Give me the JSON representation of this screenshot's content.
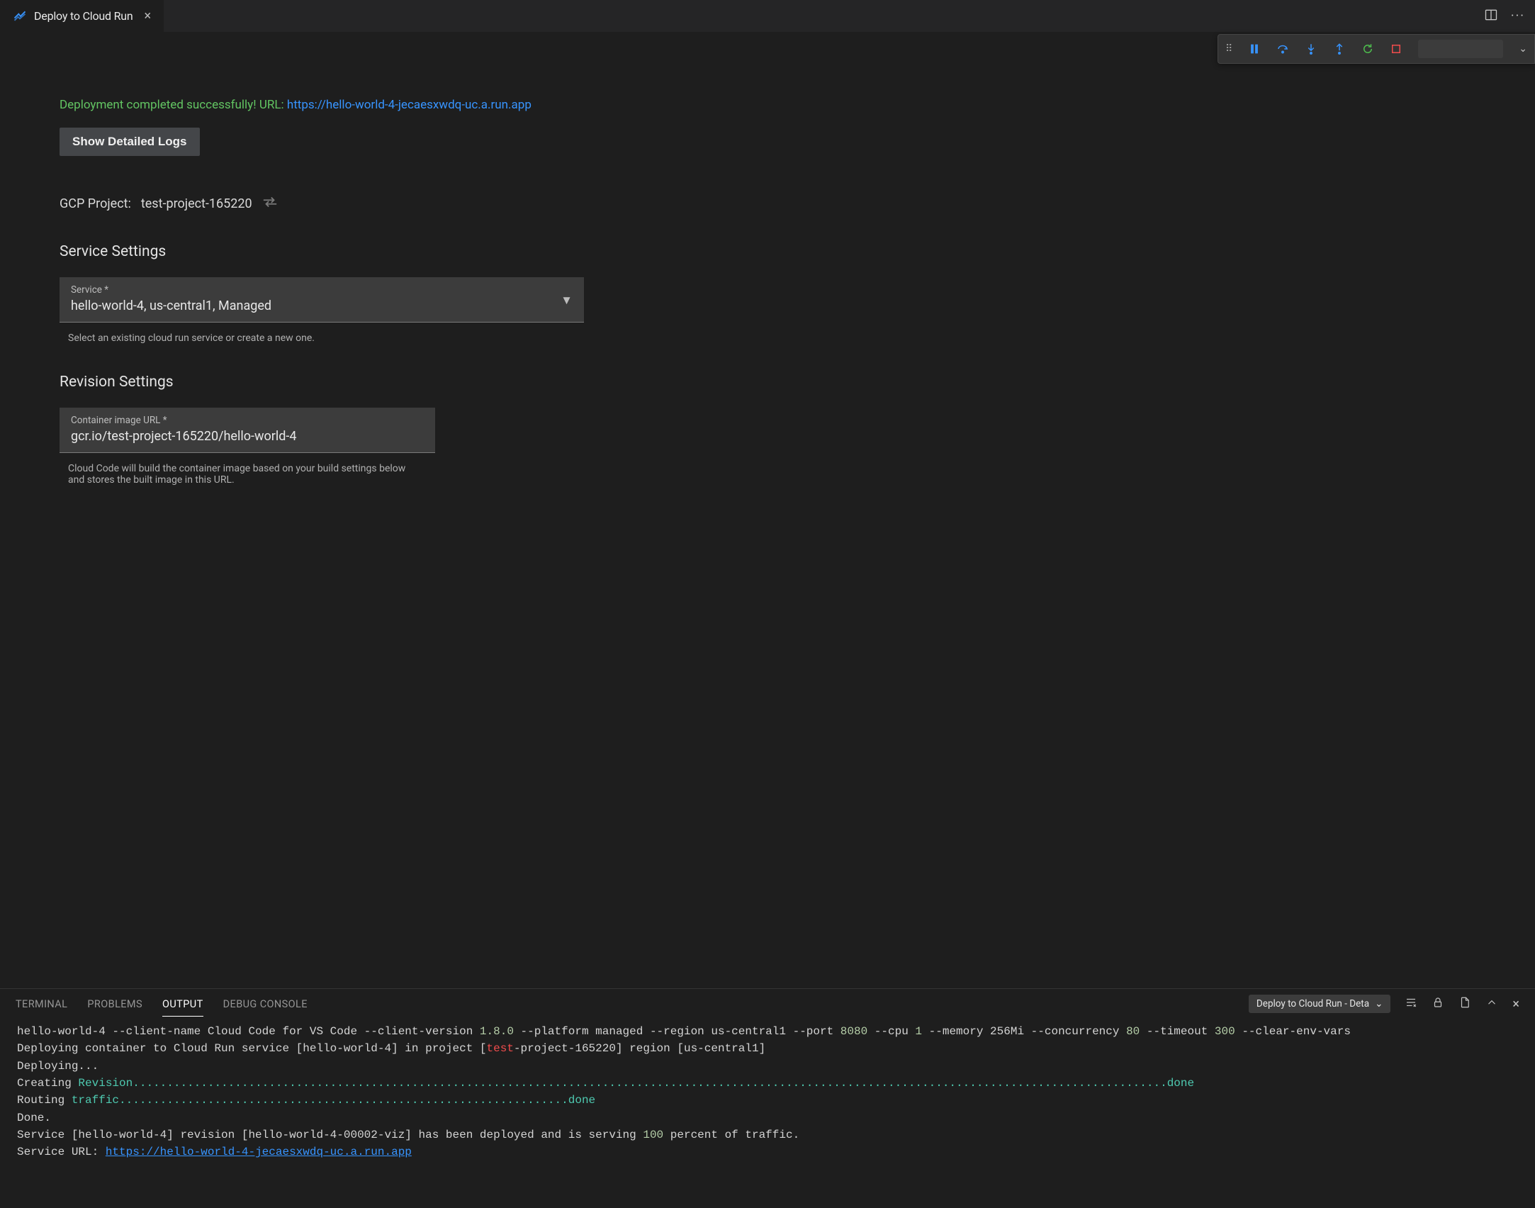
{
  "tab": {
    "title": "Deploy to Cloud Run"
  },
  "status": {
    "prefix": "Deployment completed successfully! URL: ",
    "url": "https://hello-world-4-jecaesxwdq-uc.a.run.app"
  },
  "buttons": {
    "show_logs": "Show Detailed Logs"
  },
  "project": {
    "label": "GCP Project:",
    "value": "test-project-165220"
  },
  "sections": {
    "service": "Service Settings",
    "revision": "Revision Settings"
  },
  "service_field": {
    "label": "Service *",
    "value": "hello-world-4, us-central1, Managed",
    "helper": "Select an existing cloud run service or create a new one."
  },
  "image_field": {
    "label": "Container image URL *",
    "value": "gcr.io/test-project-165220/hello-world-4",
    "helper": "Cloud Code will build the container image based on your build settings below and stores the built image in this URL."
  },
  "panel": {
    "tabs": {
      "terminal": "TERMINAL",
      "problems": "PROBLEMS",
      "output": "OUTPUT",
      "debug": "DEBUG CONSOLE"
    },
    "output_selector": "Deploy to Cloud Run - Deta"
  },
  "log": {
    "l1_a": "hello-world-4 --client-name Cloud Code for VS Code --client-version ",
    "l1_ver": "1.8.0",
    "l1_b": " --platform managed --region us-central1 --port ",
    "l2_port": "8080",
    "l2_a": " --cpu ",
    "l2_cpu": "1",
    "l2_b": " --memory 256Mi --concurrency ",
    "l2_conc": "80",
    "l2_c": " --timeout ",
    "l2_to": "300",
    "l2_d": " --clear-env-vars",
    "l3_a": "Deploying container to Cloud Run service [hello-world-4] in project [",
    "l3_red": "test",
    "l3_b": "-project-165220] region [us-central1]",
    "l4": "Deploying...",
    "l5_a": "Creating ",
    "l5_rev": "Revision",
    "l5_dots": "...............................................................................................................................................",
    "l6_dots": ".........",
    "l6_done": "done",
    "l7_a": "Routing ",
    "l7_tr": "traffic",
    "l7_dots": "..................................................................",
    "l7_done": "done",
    "l8": "Done.",
    "l9_a": "Service [hello-world-4] revision [hello-world-4-00002-viz] has been deployed and is serving ",
    "l9_pct": "100",
    "l9_b": " percent of traffic.",
    "l10_a": "Service URL: ",
    "l10_url": "https://hello-world-4-jecaesxwdq-uc.a.run.app"
  }
}
